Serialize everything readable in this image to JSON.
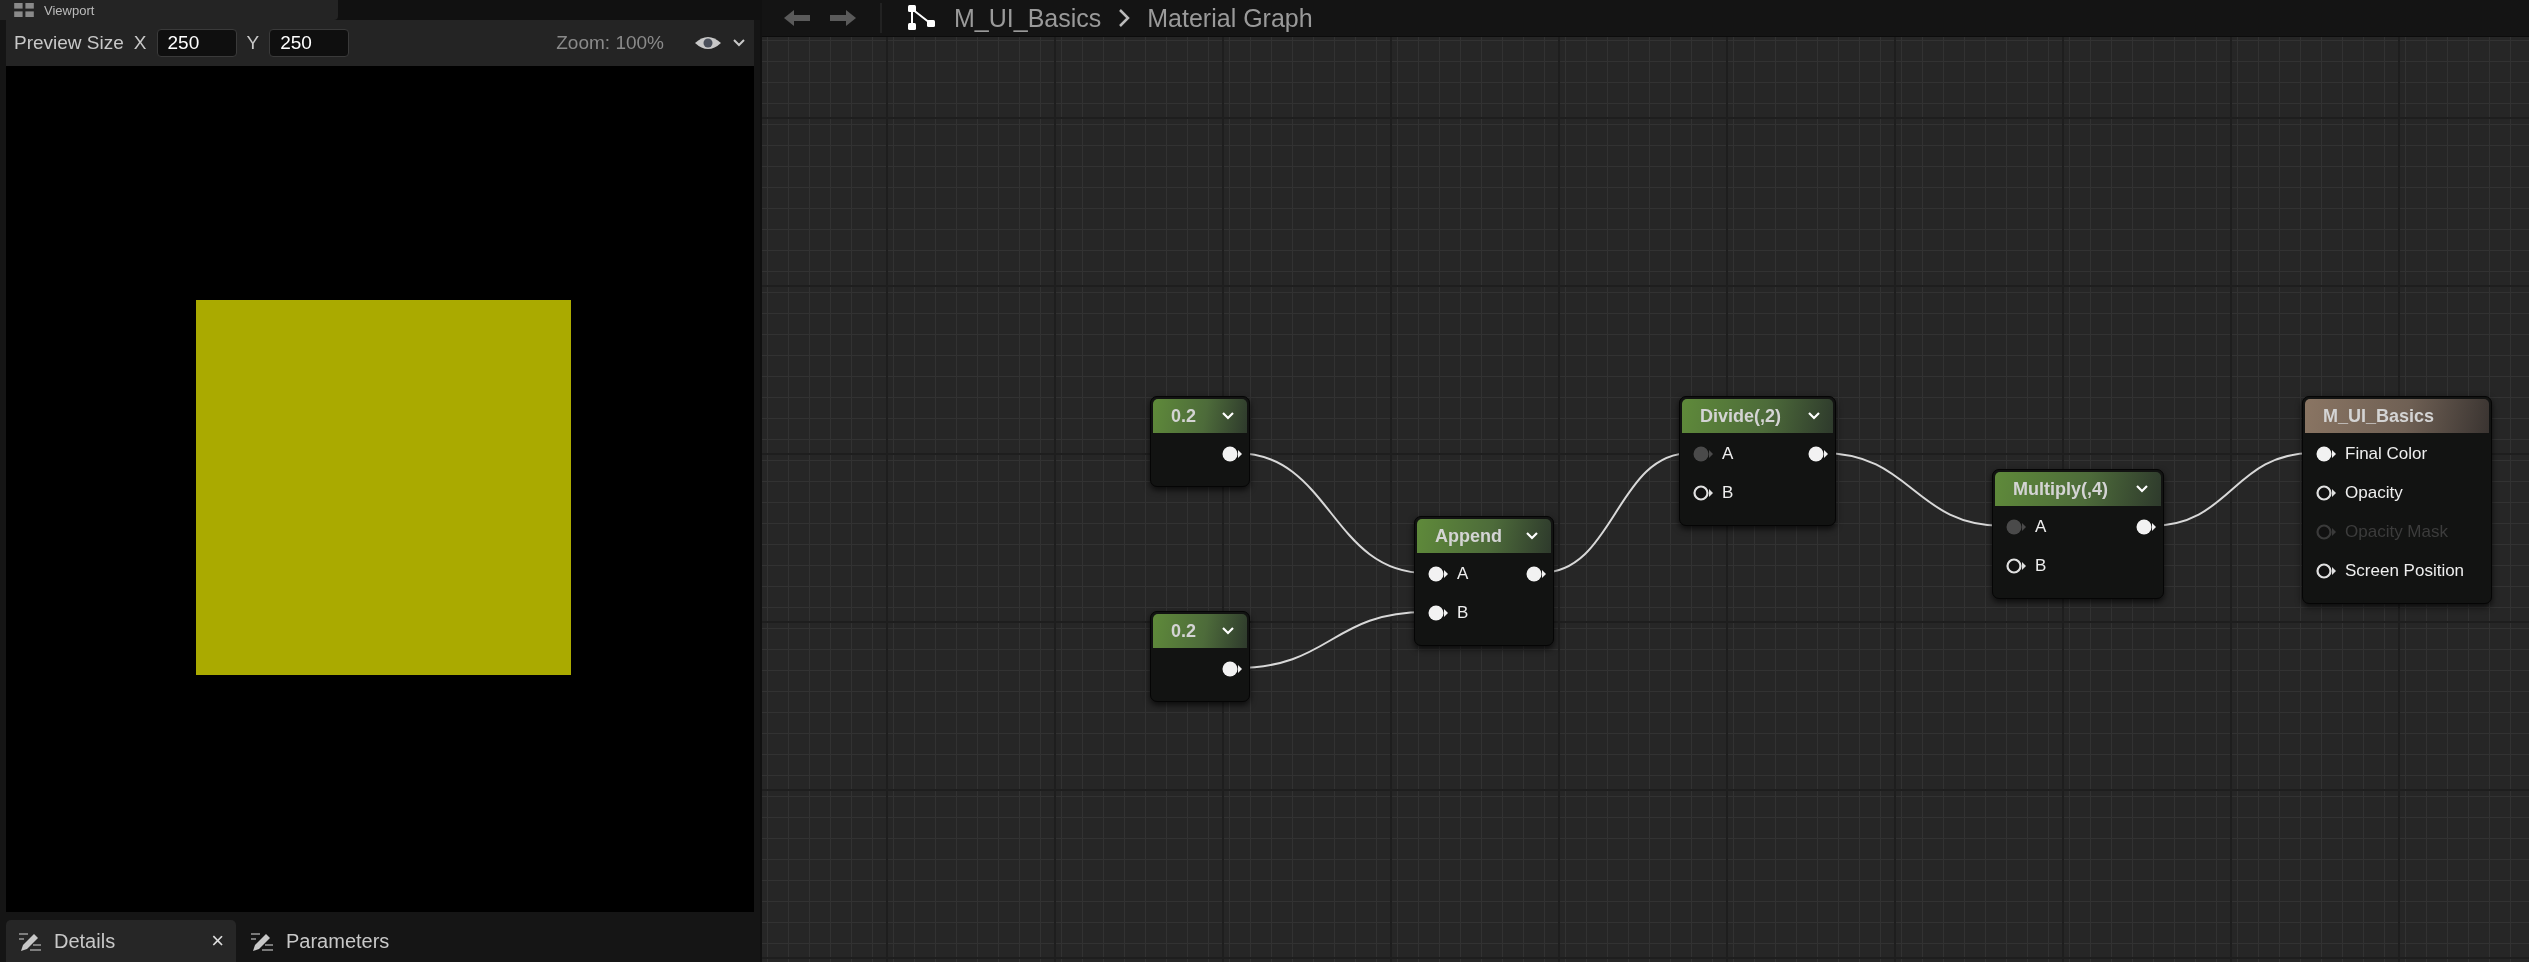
{
  "viewport_tab": {
    "label": "Viewport"
  },
  "preview": {
    "label": "Preview Size",
    "x_label": "X",
    "x_value": "250",
    "y_label": "Y",
    "y_value": "250",
    "zoom": "Zoom: 100%"
  },
  "bottom_tabs": [
    {
      "label": "Details",
      "selected": true,
      "close": "×"
    },
    {
      "label": "Parameters",
      "selected": false
    }
  ],
  "breadcrumb": [
    "M_UI_Basics",
    "Material Graph"
  ],
  "nodes": [
    {
      "title": "0.2",
      "kind": "expression",
      "output": {
        "kind": "filled"
      }
    },
    {
      "title": "0.2",
      "kind": "expression",
      "output": {
        "kind": "filled"
      }
    },
    {
      "title": "Append",
      "kind": "expression",
      "inputs": [
        {
          "label": "A",
          "kind": "filled",
          "disabled": false
        },
        {
          "label": "B",
          "kind": "filled",
          "disabled": false
        }
      ],
      "output": {
        "kind": "filled"
      }
    },
    {
      "title": "Divide(,2)",
      "kind": "expression",
      "inputs": [
        {
          "label": "A",
          "kind": "dimmed",
          "disabled": false
        },
        {
          "label": "B",
          "kind": "hollow",
          "disabled": false
        }
      ],
      "output": {
        "kind": "filled"
      }
    },
    {
      "title": "Multiply(,4)",
      "kind": "expression",
      "inputs": [
        {
          "label": "A",
          "kind": "dimmed",
          "disabled": false
        },
        {
          "label": "B",
          "kind": "hollow",
          "disabled": false
        }
      ],
      "output": {
        "kind": "filled"
      }
    },
    {
      "title": "M_UI_Basics",
      "kind": "result",
      "inputs": [
        {
          "label": "Final Color",
          "kind": "filled",
          "disabled": false
        },
        {
          "label": "Opacity",
          "kind": "hollow",
          "disabled": false
        },
        {
          "label": "Opacity Mask",
          "kind": "hollow",
          "disabled": true
        },
        {
          "label": "Screen Position",
          "kind": "hollow",
          "disabled": false
        }
      ]
    }
  ]
}
